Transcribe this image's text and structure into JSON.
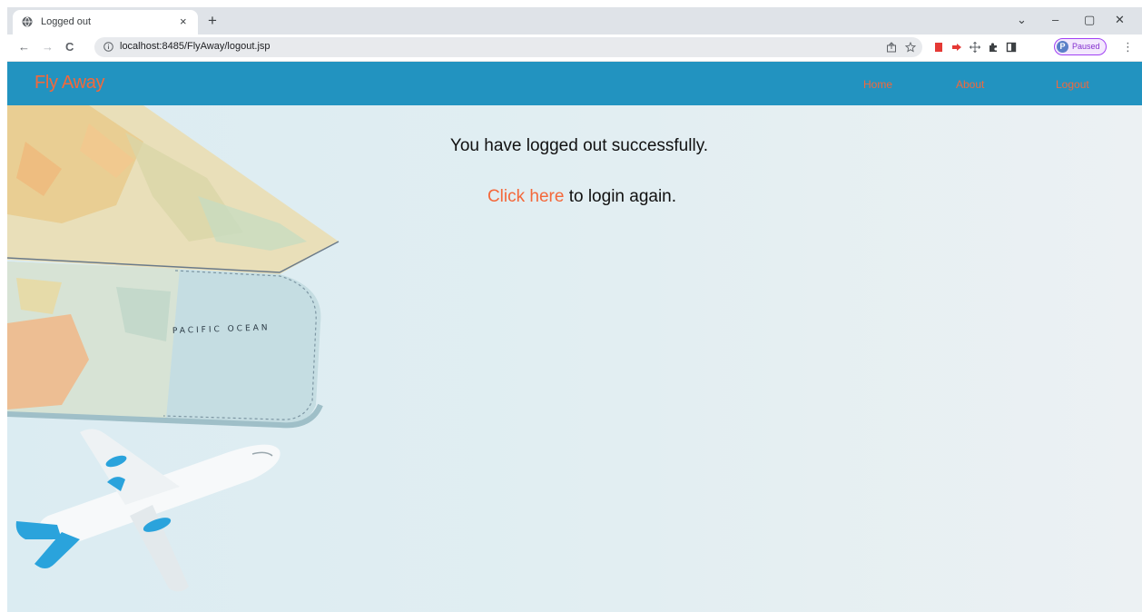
{
  "browser": {
    "tab": {
      "title": "Logged out",
      "close_glyph": "×"
    },
    "new_tab_glyph": "+",
    "window_controls": {
      "tab_search": "⌄",
      "minimize": "–",
      "restore": "▢",
      "close": "✕"
    },
    "nav": {
      "back": "←",
      "forward": "→",
      "reload": "C"
    },
    "url": "localhost:8485/FlyAway/logout.jsp",
    "profile": {
      "initial": "P",
      "label": "Paused"
    },
    "menu_glyph": "⋮",
    "icons": [
      "info-icon",
      "share-icon",
      "star-icon",
      "extension-red-icon",
      "extension-arrow-icon",
      "extension-move-icon",
      "puzzle-icon",
      "side-panel-icon"
    ]
  },
  "site": {
    "brand": "Fly Away",
    "nav": {
      "home": "Home",
      "about": "About",
      "logout": "Logout"
    },
    "hero_map_label": "PACIFIC OCEAN",
    "message": "You have logged out successfully.",
    "login_link": "Click here",
    "login_suffix": " to login again."
  },
  "colors": {
    "navbar": "#2293c0",
    "accent": "#f4683a",
    "page_background": "#e2eef2"
  }
}
